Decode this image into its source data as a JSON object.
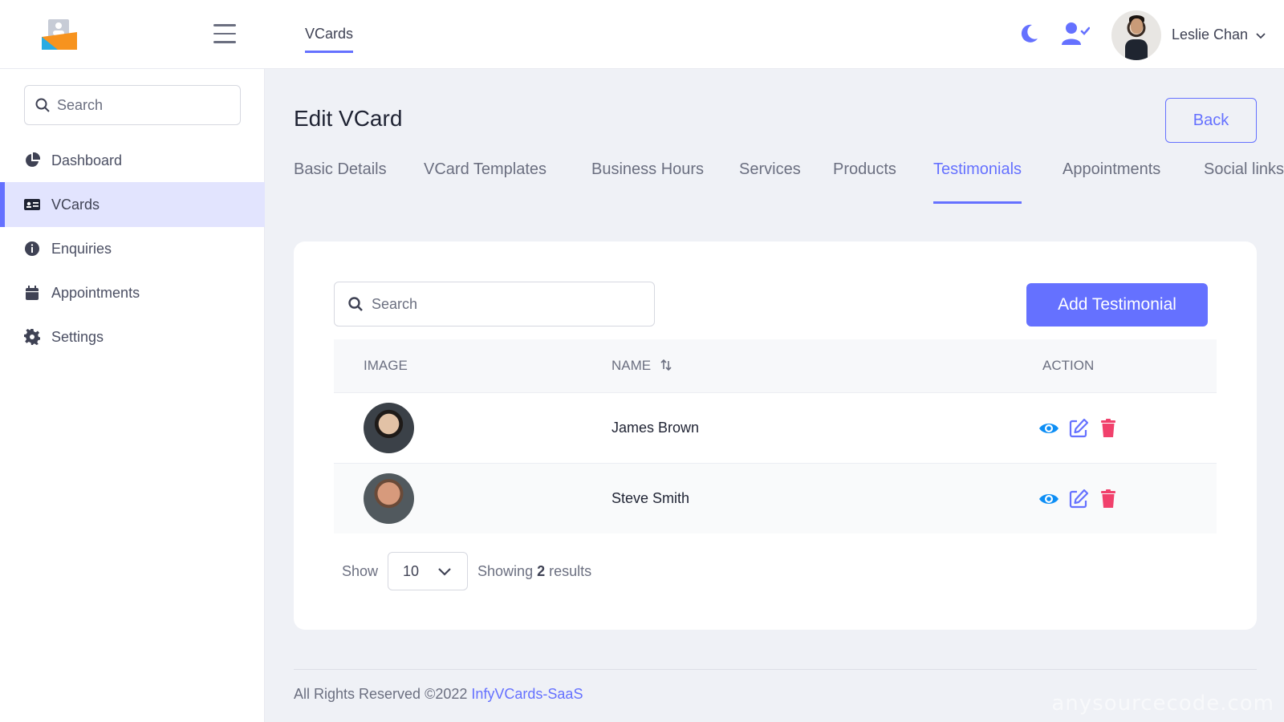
{
  "header": {
    "logo_name": "app-logo",
    "top_tab": "VCards",
    "user_name": "Leslie Chan"
  },
  "sidebar": {
    "search_placeholder": "Search",
    "items": [
      {
        "label": "Dashboard",
        "icon": "pie-chart-icon"
      },
      {
        "label": "VCards",
        "icon": "id-card-icon",
        "active": true
      },
      {
        "label": "Enquiries",
        "icon": "info-circle-icon"
      },
      {
        "label": "Appointments",
        "icon": "calendar-icon"
      },
      {
        "label": "Settings",
        "icon": "gear-icon"
      }
    ]
  },
  "main": {
    "title": "Edit VCard",
    "back_label": "Back",
    "tabs": [
      {
        "label": "Basic Details"
      },
      {
        "label": "VCard Templates"
      },
      {
        "label": "Business Hours"
      },
      {
        "label": "Services"
      },
      {
        "label": "Products"
      },
      {
        "label": "Testimonials",
        "active": true
      },
      {
        "label": "Appointments"
      },
      {
        "label": "Social links"
      }
    ]
  },
  "testimonials": {
    "search_placeholder": "Search",
    "add_label": "Add Testimonial",
    "columns": [
      "IMAGE",
      "NAME",
      "ACTION"
    ],
    "rows": [
      {
        "name": "James Brown"
      },
      {
        "name": "Steve Smith"
      }
    ],
    "pager": {
      "show_label": "Show",
      "page_size": "10",
      "results_prefix": "Showing",
      "results_count": "2",
      "results_suffix": "results"
    }
  },
  "footer": {
    "text": "All Rights Reserved ©2022",
    "link": "InfyVCards-SaaS"
  },
  "watermark": "anysourcecode.com",
  "colors": {
    "accent": "#6571ff",
    "view": "#0d8ef5",
    "delete": "#f1416c",
    "background": "#eff1f6"
  }
}
